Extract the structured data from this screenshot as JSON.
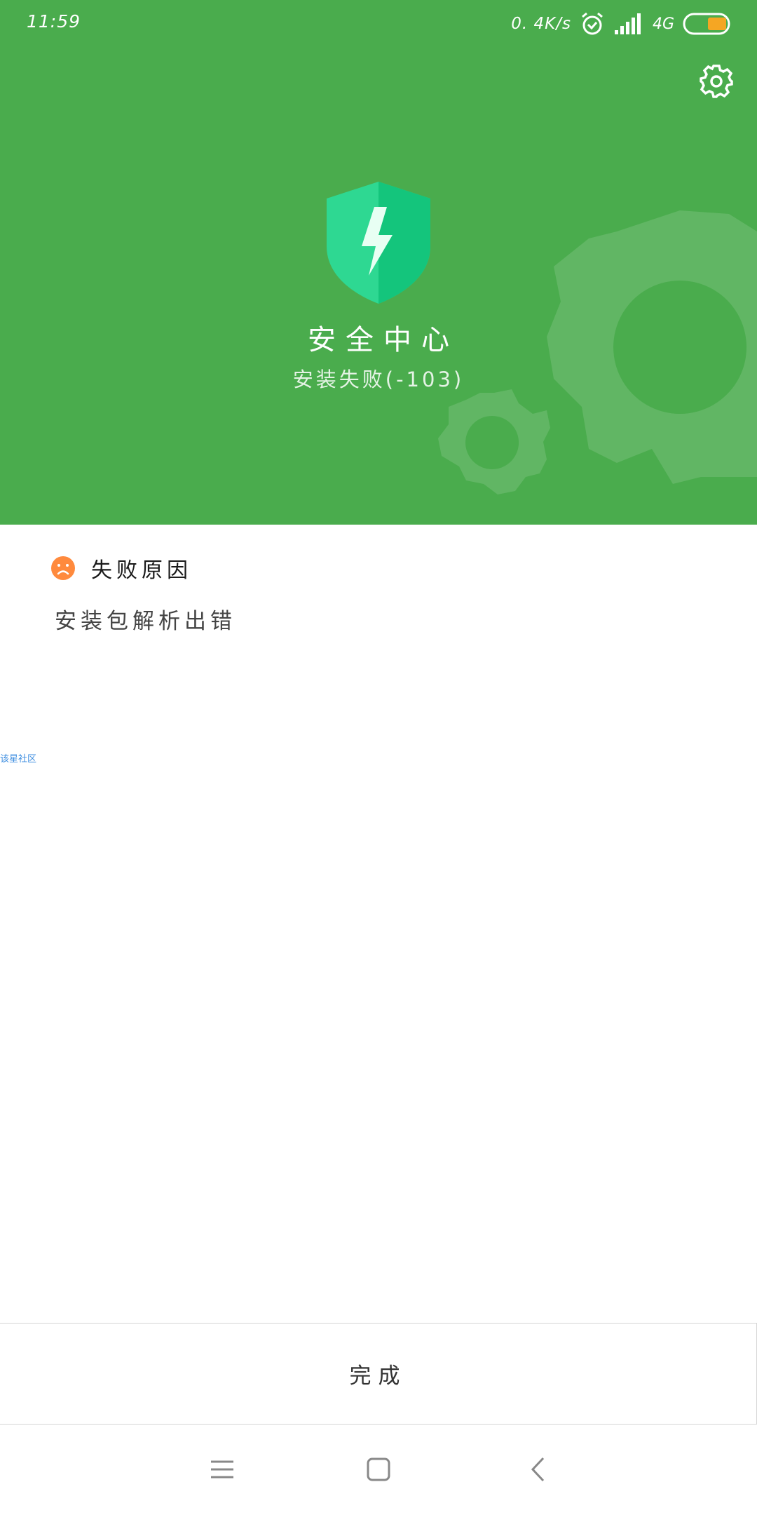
{
  "status_bar": {
    "time": "11:59",
    "net_speed": "0. 4K/s",
    "network_type": "4G",
    "battery_color": "#f5a623"
  },
  "header": {
    "background_color": "#4aac4d",
    "app_title": "安全中心",
    "subtitle": "安装失败(-103)",
    "settings_icon": "gear-icon",
    "logo_icon": "shield-bolt-icon"
  },
  "failure": {
    "icon": "sad-face-icon",
    "icon_color": "#ff8a3d",
    "title": "失败原因",
    "reason": "安装包解析出错"
  },
  "watermark": "该星社区",
  "footer": {
    "done_label": "完成"
  },
  "nav_bar": {
    "menu_icon": "menu-icon",
    "home_icon": "home-icon",
    "back_icon": "back-icon"
  }
}
